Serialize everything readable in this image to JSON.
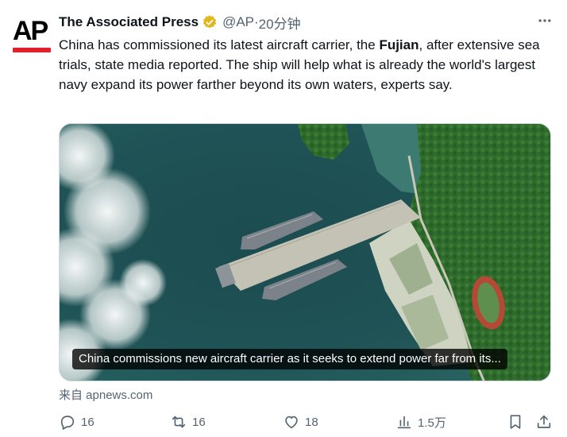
{
  "post": {
    "author_name": "The Associated Press",
    "verified_badge_icon": "verified-gold-badge-icon",
    "handle": "@AP",
    "separator": " · ",
    "time": "20分钟",
    "avatar_text": "AP",
    "text_before": "China has commissioned its latest aircraft carrier, the ",
    "text_bold": "Fujian",
    "text_after": ", after extensive sea trials, state media reported. The ship will help what is already the world's largest navy expand its power farther beyond its own waters, experts say."
  },
  "card": {
    "headline": "China commissions new aircraft carrier as it seeks to extend power far from its...",
    "source": "来自 apnews.com"
  },
  "actions": {
    "replies": "16",
    "reposts": "16",
    "likes": "18",
    "views": "1.5万"
  },
  "colors": {
    "text": "#0f1419",
    "secondary": "#536471",
    "ap_red": "#e0202a",
    "badge_gold": "#e2b719"
  }
}
